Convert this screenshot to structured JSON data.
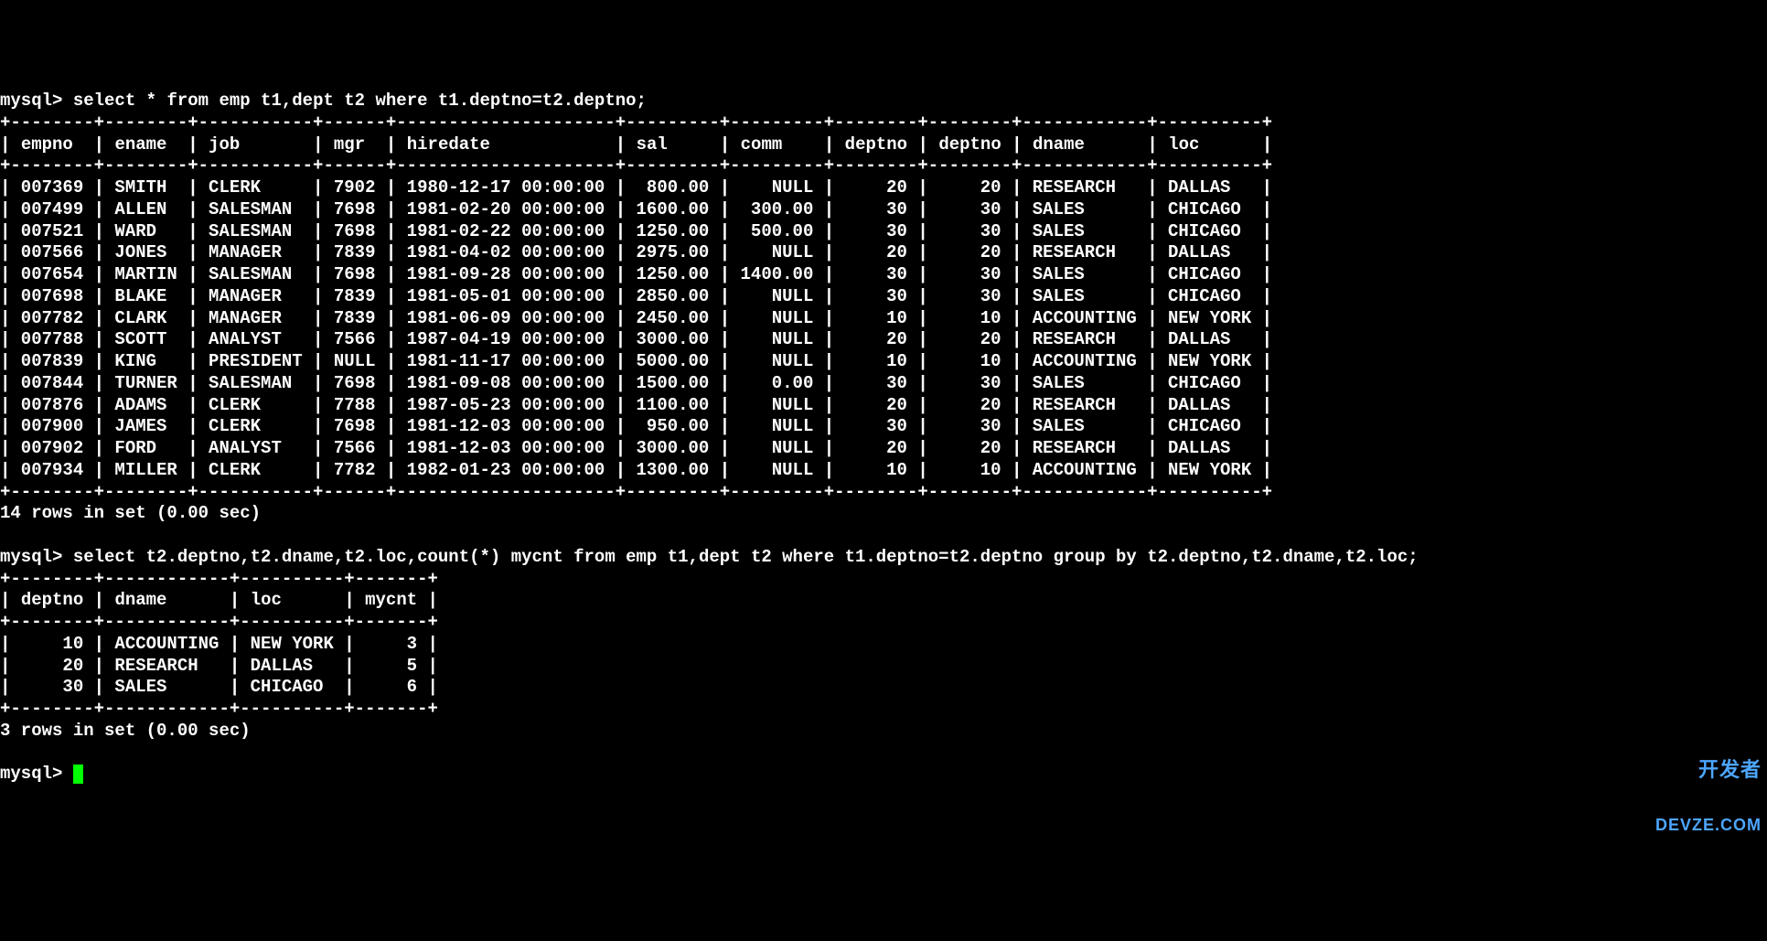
{
  "prompt": "mysql>",
  "query1": {
    "command": "select * from emp t1,dept t2 where t1.deptno=t2.deptno;",
    "headers": [
      "empno",
      "ename",
      "job",
      "mgr",
      "hiredate",
      "sal",
      "comm",
      "deptno",
      "deptno",
      "dname",
      "loc"
    ],
    "rows": [
      {
        "empno": "007369",
        "ename": "SMITH",
        "job": "CLERK",
        "mgr": "7902",
        "hiredate": "1980-12-17 00:00:00",
        "sal": "800.00",
        "comm": "NULL",
        "deptno1": "20",
        "deptno2": "20",
        "dname": "RESEARCH",
        "loc": "DALLAS"
      },
      {
        "empno": "007499",
        "ename": "ALLEN",
        "job": "SALESMAN",
        "mgr": "7698",
        "hiredate": "1981-02-20 00:00:00",
        "sal": "1600.00",
        "comm": "300.00",
        "deptno1": "30",
        "deptno2": "30",
        "dname": "SALES",
        "loc": "CHICAGO"
      },
      {
        "empno": "007521",
        "ename": "WARD",
        "job": "SALESMAN",
        "mgr": "7698",
        "hiredate": "1981-02-22 00:00:00",
        "sal": "1250.00",
        "comm": "500.00",
        "deptno1": "30",
        "deptno2": "30",
        "dname": "SALES",
        "loc": "CHICAGO"
      },
      {
        "empno": "007566",
        "ename": "JONES",
        "job": "MANAGER",
        "mgr": "7839",
        "hiredate": "1981-04-02 00:00:00",
        "sal": "2975.00",
        "comm": "NULL",
        "deptno1": "20",
        "deptno2": "20",
        "dname": "RESEARCH",
        "loc": "DALLAS"
      },
      {
        "empno": "007654",
        "ename": "MARTIN",
        "job": "SALESMAN",
        "mgr": "7698",
        "hiredate": "1981-09-28 00:00:00",
        "sal": "1250.00",
        "comm": "1400.00",
        "deptno1": "30",
        "deptno2": "30",
        "dname": "SALES",
        "loc": "CHICAGO"
      },
      {
        "empno": "007698",
        "ename": "BLAKE",
        "job": "MANAGER",
        "mgr": "7839",
        "hiredate": "1981-05-01 00:00:00",
        "sal": "2850.00",
        "comm": "NULL",
        "deptno1": "30",
        "deptno2": "30",
        "dname": "SALES",
        "loc": "CHICAGO"
      },
      {
        "empno": "007782",
        "ename": "CLARK",
        "job": "MANAGER",
        "mgr": "7839",
        "hiredate": "1981-06-09 00:00:00",
        "sal": "2450.00",
        "comm": "NULL",
        "deptno1": "10",
        "deptno2": "10",
        "dname": "ACCOUNTING",
        "loc": "NEW YORK"
      },
      {
        "empno": "007788",
        "ename": "SCOTT",
        "job": "ANALYST",
        "mgr": "7566",
        "hiredate": "1987-04-19 00:00:00",
        "sal": "3000.00",
        "comm": "NULL",
        "deptno1": "20",
        "deptno2": "20",
        "dname": "RESEARCH",
        "loc": "DALLAS"
      },
      {
        "empno": "007839",
        "ename": "KING",
        "job": "PRESIDENT",
        "mgr": "NULL",
        "hiredate": "1981-11-17 00:00:00",
        "sal": "5000.00",
        "comm": "NULL",
        "deptno1": "10",
        "deptno2": "10",
        "dname": "ACCOUNTING",
        "loc": "NEW YORK"
      },
      {
        "empno": "007844",
        "ename": "TURNER",
        "job": "SALESMAN",
        "mgr": "7698",
        "hiredate": "1981-09-08 00:00:00",
        "sal": "1500.00",
        "comm": "0.00",
        "deptno1": "30",
        "deptno2": "30",
        "dname": "SALES",
        "loc": "CHICAGO"
      },
      {
        "empno": "007876",
        "ename": "ADAMS",
        "job": "CLERK",
        "mgr": "7788",
        "hiredate": "1987-05-23 00:00:00",
        "sal": "1100.00",
        "comm": "NULL",
        "deptno1": "20",
        "deptno2": "20",
        "dname": "RESEARCH",
        "loc": "DALLAS"
      },
      {
        "empno": "007900",
        "ename": "JAMES",
        "job": "CLERK",
        "mgr": "7698",
        "hiredate": "1981-12-03 00:00:00",
        "sal": "950.00",
        "comm": "NULL",
        "deptno1": "30",
        "deptno2": "30",
        "dname": "SALES",
        "loc": "CHICAGO"
      },
      {
        "empno": "007902",
        "ename": "FORD",
        "job": "ANALYST",
        "mgr": "7566",
        "hiredate": "1981-12-03 00:00:00",
        "sal": "3000.00",
        "comm": "NULL",
        "deptno1": "20",
        "deptno2": "20",
        "dname": "RESEARCH",
        "loc": "DALLAS"
      },
      {
        "empno": "007934",
        "ename": "MILLER",
        "job": "CLERK",
        "mgr": "7782",
        "hiredate": "1982-01-23 00:00:00",
        "sal": "1300.00",
        "comm": "NULL",
        "deptno1": "10",
        "deptno2": "10",
        "dname": "ACCOUNTING",
        "loc": "NEW YORK"
      }
    ],
    "footer": "14 rows in set (0.00 sec)"
  },
  "query2": {
    "command": "select t2.deptno,t2.dname,t2.loc,count(*) mycnt from emp t1,dept t2 where t1.deptno=t2.deptno group by t2.deptno,t2.dname,t2.loc;",
    "headers": [
      "deptno",
      "dname",
      "loc",
      "mycnt"
    ],
    "rows": [
      {
        "deptno": "10",
        "dname": "ACCOUNTING",
        "loc": "NEW YORK",
        "mycnt": "3"
      },
      {
        "deptno": "20",
        "dname": "RESEARCH",
        "loc": "DALLAS",
        "mycnt": "5"
      },
      {
        "deptno": "30",
        "dname": "SALES",
        "loc": "CHICAGO",
        "mycnt": "6"
      }
    ],
    "footer": "3 rows in set (0.00 sec)"
  },
  "watermark": {
    "line1": "开发者",
    "line2": "DEVZE.COM"
  }
}
